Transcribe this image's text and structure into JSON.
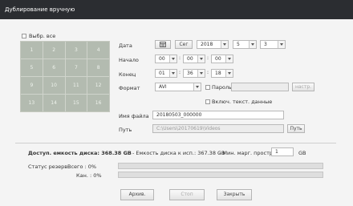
{
  "title": "Дублирование вручную",
  "select_all": "Выбр. все",
  "channels": [
    "1",
    "2",
    "3",
    "4",
    "5",
    "6",
    "7",
    "8",
    "9",
    "10",
    "11",
    "12",
    "13",
    "14",
    "15",
    "16"
  ],
  "labels": {
    "date": "Дата",
    "start": "Начало",
    "end": "Конец",
    "format": "Формат",
    "filename": "Имя файла",
    "path": "Путь"
  },
  "date": {
    "today": "Сег",
    "year": "2018",
    "month": "5",
    "day": "3"
  },
  "start_time": {
    "h": "00",
    "m": "00",
    "s": "00"
  },
  "end_time": {
    "h": "01",
    "m": "36",
    "s": "18"
  },
  "format": {
    "value": "AVI",
    "password_label": "Пароль",
    "settings_button": "настр.",
    "include_text": "Включ. текст. данные"
  },
  "filename": "20180503_000000",
  "path": {
    "value": "C:\\Users\\20170619\\Videos",
    "button": "Путь"
  },
  "disk": {
    "available": "Доступ. емкость диска: 368.38 GB",
    "usable": "- Емкость диска к исп.: 367.38 GB",
    "min_free_label": "- Мин. марг. простр.:",
    "min_free_value": "1",
    "unit": "GB"
  },
  "status": {
    "title": "Статус резерв.",
    "total_label": "Всего : 0%",
    "channel_label": "Кан. : 0%",
    "total_progress": 0,
    "channel_progress": 0
  },
  "buttons": {
    "archive": "Архив.",
    "stop": "Стоп",
    "close": "Закрыть"
  }
}
